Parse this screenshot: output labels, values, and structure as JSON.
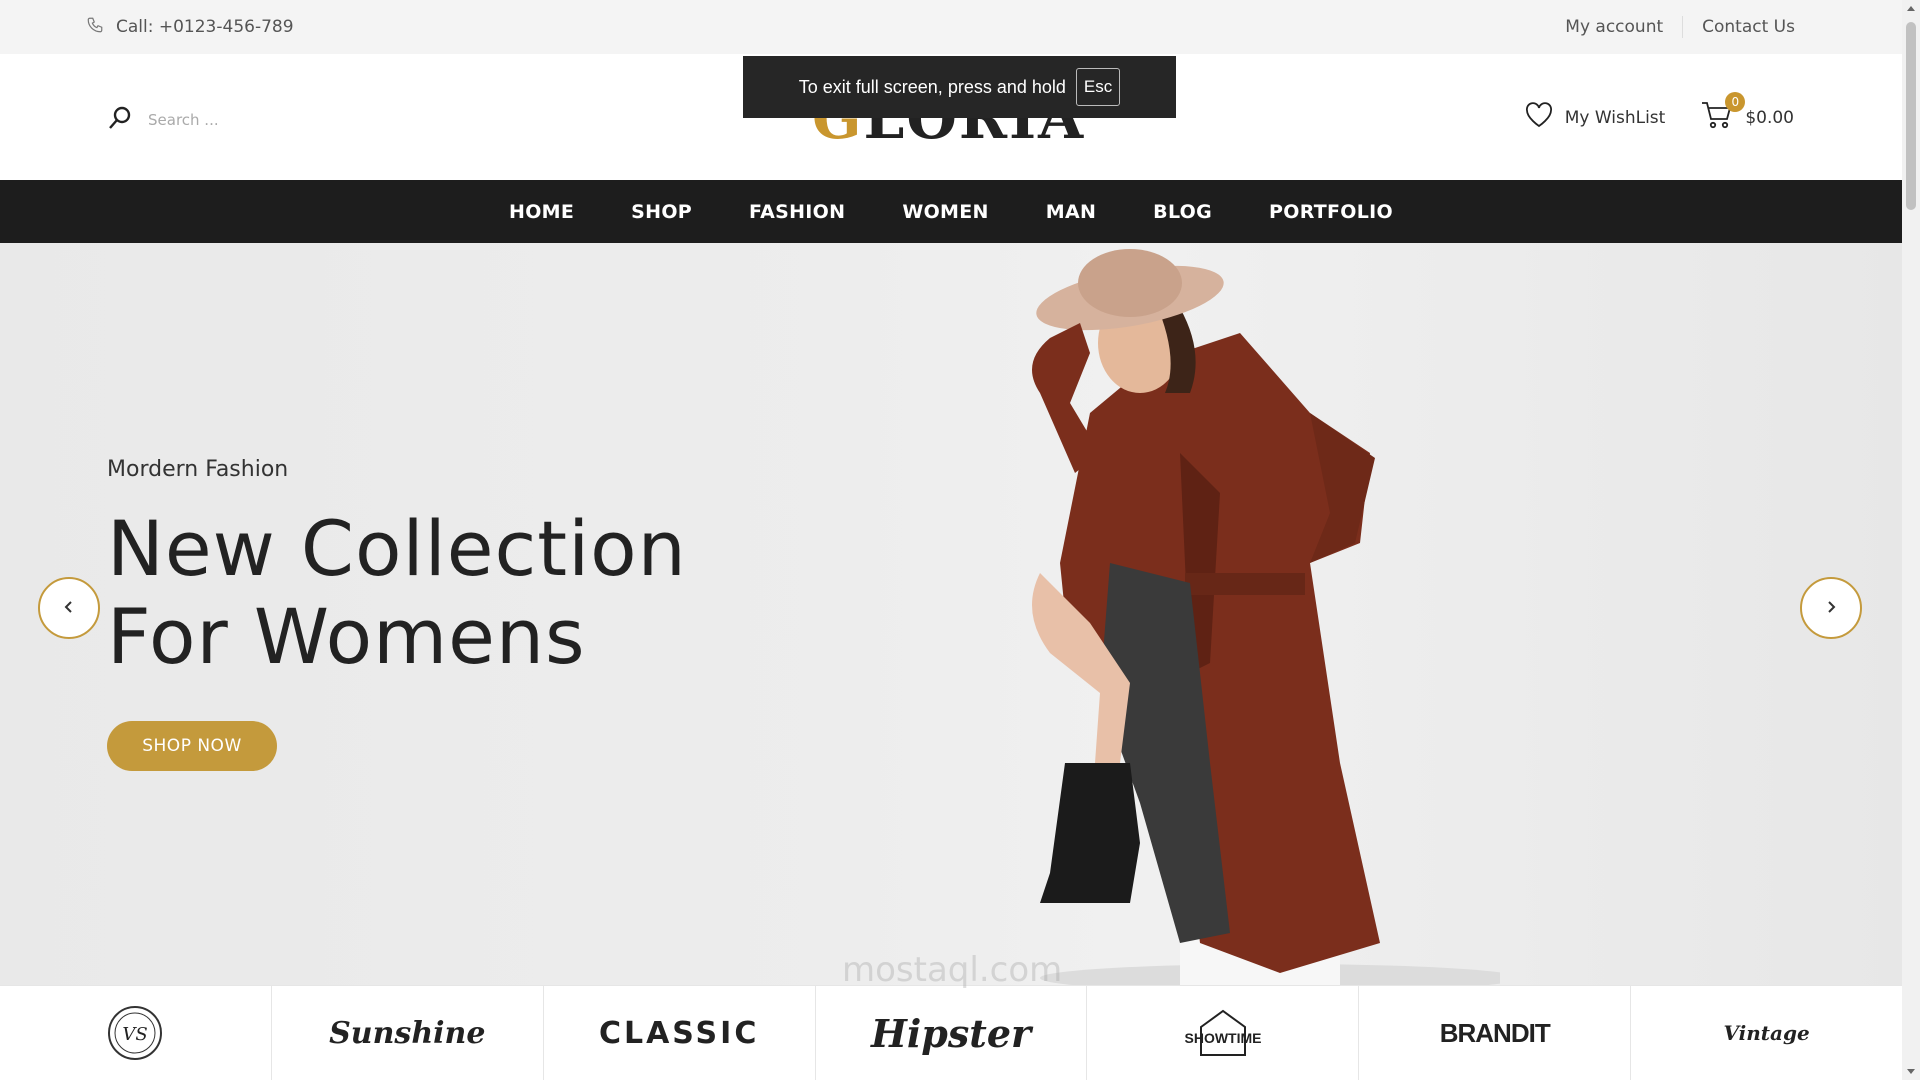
{
  "topbar": {
    "call": "Call: +0123-456-789",
    "my_account": "My account",
    "contact_us": "Contact Us"
  },
  "header": {
    "search_placeholder": "Search ...",
    "logo_first": "G",
    "logo_rest": "LORIA",
    "wishlist": "My WishList",
    "cart_count": "0",
    "cart_total": "$0.00"
  },
  "toast": {
    "message": "To exit full screen, press and hold",
    "key": "Esc"
  },
  "nav": {
    "items": [
      "HOME",
      "SHOP",
      "FASHION",
      "WOMEN",
      "MAN",
      "BLOG",
      "PORTFOLIO"
    ]
  },
  "hero": {
    "subtitle": "Mordern Fashion",
    "title_line1": "New Collection",
    "title_line2": "For Womens",
    "button": "SHOP NOW"
  },
  "brands": {
    "items": [
      "VS",
      "Sunshine",
      "CLASSIC",
      "Hipster",
      "SHOWTIME",
      "BRANDIT",
      "Vintage"
    ]
  },
  "watermark": "mostaql.com",
  "colors": {
    "accent": "#c49a3c",
    "nav_bg": "#1d1d1d",
    "topbar_bg": "#f4f4f4"
  }
}
